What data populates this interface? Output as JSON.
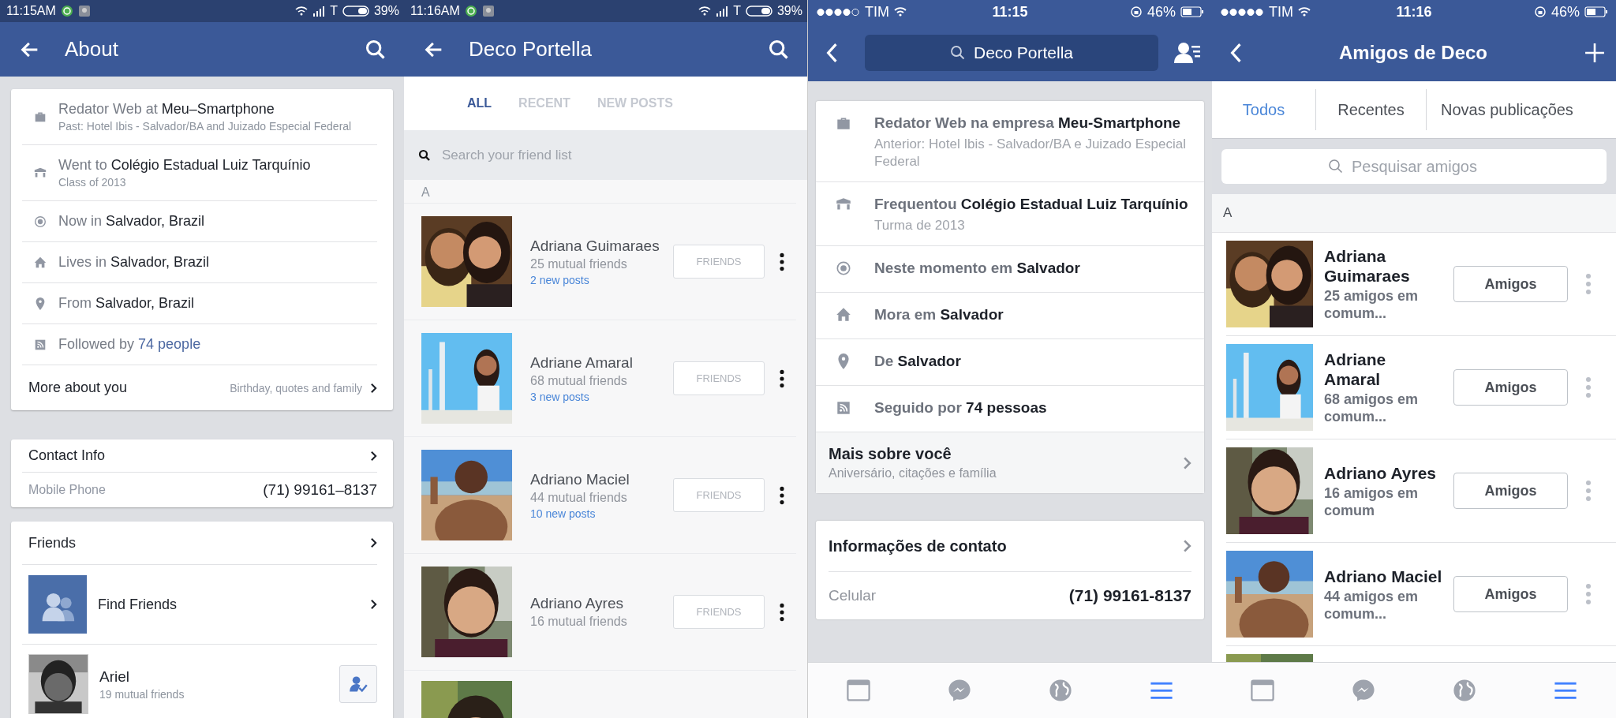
{
  "about_screen": {
    "status_bar": {
      "time": "11:15AM",
      "carrier": "T",
      "battery": "39%"
    },
    "header": {
      "title": "About"
    },
    "info_rows": [
      {
        "kind": "work",
        "prefix": "Redator Web at",
        "value": "Meu–Smartphone",
        "sub": "Past: Hotel Ibis - Salvador/BA and Juizado Especial Federal",
        "link": false
      },
      {
        "kind": "school",
        "prefix": "Went to",
        "value": "Colégio Estadual Luiz Tarquínio",
        "sub": "Class of 2013",
        "link": false
      },
      {
        "kind": "now",
        "prefix": "Now in",
        "value": "Salvador, Brazil",
        "link": false
      },
      {
        "kind": "home",
        "prefix": "Lives in",
        "value": "Salvador, Brazil",
        "link": false
      },
      {
        "kind": "pin",
        "prefix": "From",
        "value": "Salvador, Brazil",
        "link": false
      },
      {
        "kind": "follow",
        "prefix": "Followed by",
        "value": "74 people",
        "link": true
      }
    ],
    "more": {
      "label": "More about you",
      "hint": "Birthday, quotes and family"
    },
    "contact": {
      "title": "Contact Info",
      "field": "Mobile Phone",
      "value": "(71) 99161–8137"
    },
    "friends": {
      "title": "Friends",
      "find": "Find Friends",
      "person": {
        "name": "Ariel",
        "mutual": "19 mutual friends"
      }
    }
  },
  "friends_screen": {
    "status_bar": {
      "time": "11:16AM",
      "carrier": "T",
      "battery": "39%"
    },
    "header": {
      "title": "Deco Portella"
    },
    "tabs": [
      {
        "label": "ALL",
        "selected": true
      },
      {
        "label": "RECENT",
        "selected": false
      },
      {
        "label": "NEW POSTS",
        "selected": false
      }
    ],
    "search": {
      "placeholder": "Search your friend list"
    },
    "section": "A",
    "friends": [
      {
        "name": "Adriana Guimaraes",
        "mutual": "25 mutual friends",
        "new_posts": "2 new posts",
        "button": "FRIENDS"
      },
      {
        "name": "Adriane Amaral",
        "mutual": "68 mutual friends",
        "new_posts": "3 new posts",
        "button": "FRIENDS"
      },
      {
        "name": "Adriano Maciel",
        "mutual": "44 mutual friends",
        "new_posts": "10 new posts",
        "button": "FRIENDS"
      },
      {
        "name": "Adriano Ayres",
        "mutual": "16 mutual friends",
        "button": "FRIENDS"
      }
    ]
  },
  "ios_about_screen": {
    "status_bar": {
      "carrier": "TIM",
      "time": "11:15",
      "battery": "46%"
    },
    "header": {
      "search_value": "Deco Portella"
    },
    "info_rows": [
      {
        "kind": "work",
        "prefix": "Redator Web na empresa",
        "value": "Meu-Smartphone",
        "sub": "Anterior: Hotel Ibis - Salvador/BA e Juizado Especial Federal"
      },
      {
        "kind": "school",
        "prefix": "Frequentou",
        "value": "Colégio Estadual Luiz Tarquínio",
        "sub": "Turma de 2013"
      },
      {
        "kind": "now",
        "prefix": "Neste momento em",
        "value": "Salvador"
      },
      {
        "kind": "home",
        "prefix": "Mora em",
        "value": "Salvador"
      },
      {
        "kind": "pin",
        "prefix": "De",
        "value": "Salvador"
      },
      {
        "kind": "follow",
        "prefix": "Seguido por",
        "value": "74 pessoas"
      }
    ],
    "more": {
      "label": "Mais sobre você",
      "hint": "Aniversário, citações e família"
    },
    "contact": {
      "title": "Informações de contato",
      "field": "Celular",
      "value": "(71) 99161-8137"
    },
    "tab_bar": [
      {
        "kind": "feed",
        "selected": false
      },
      {
        "kind": "messenger",
        "selected": false
      },
      {
        "kind": "globe",
        "selected": false
      },
      {
        "kind": "menu",
        "selected": true
      }
    ]
  },
  "ios_friends_screen": {
    "status_bar": {
      "carrier": "TIM",
      "time": "11:16",
      "battery": "46%"
    },
    "header": {
      "title": "Amigos de Deco"
    },
    "tabs": [
      {
        "label": "Todos",
        "selected": true
      },
      {
        "label": "Recentes",
        "selected": false
      },
      {
        "label": "Novas publicações",
        "selected": false
      }
    ],
    "search": {
      "placeholder": "Pesquisar amigos"
    },
    "section": "A",
    "friends": [
      {
        "name": "Adriana Guimaraes",
        "mutual": "25 amigos em comum...",
        "button": "Amigos"
      },
      {
        "name": "Adriane Amaral",
        "mutual": "68 amigos em comum...",
        "button": "Amigos"
      },
      {
        "name": "Adriano Ayres",
        "mutual": "16 amigos em comum",
        "button": "Amigos"
      },
      {
        "name": "Adriano Maciel",
        "mutual": "44 amigos em comum...",
        "button": "Amigos"
      }
    ],
    "tab_bar": [
      {
        "kind": "feed",
        "selected": false
      },
      {
        "kind": "messenger",
        "selected": false
      },
      {
        "kind": "globe",
        "selected": false
      },
      {
        "kind": "menu",
        "selected": true
      }
    ]
  }
}
